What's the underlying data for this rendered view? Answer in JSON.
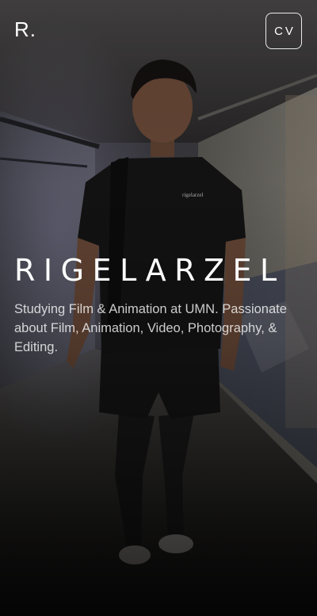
{
  "header": {
    "logo_text": "R.",
    "cv_label": "CV"
  },
  "hero": {
    "title": "RIGELARZEL",
    "subtitle": "Studying Film & Animation at UMN. Passionate about Film, Animation, Video, Photography, & Editing."
  },
  "colors": {
    "text": "#ffffff",
    "subtitle": "#c8c8c8",
    "background": "#111111"
  }
}
